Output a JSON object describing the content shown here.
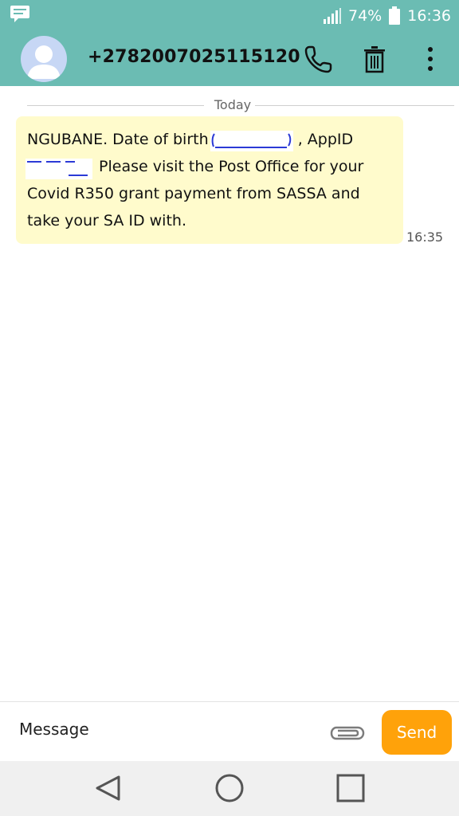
{
  "status_bar": {
    "battery": "74%",
    "time": "16:36"
  },
  "conversation": {
    "contact": "+2782007025115120"
  },
  "thread": {
    "date_label": "Today",
    "message": {
      "line1_start": "NGUBANE. Date of birth",
      "line1_end": ", AppID",
      "line2_rest": "Please visit the Post Office for your",
      "line3": "Covid R350 grant payment from SASSA and",
      "line4": "take your SA ID with.",
      "time": "16:35"
    }
  },
  "composer": {
    "placeholder": "Message",
    "send_label": "Send"
  },
  "colors": {
    "accent": "#6bbcb3",
    "bubble": "#fffbcc",
    "send": "#ffa20a"
  },
  "icons": {
    "status_left": "message-notification-icon",
    "signal": "signal-icon",
    "battery": "battery-icon",
    "call": "phone-icon",
    "delete": "trash-icon",
    "more": "more-vertical-icon",
    "attach": "paperclip-icon",
    "back": "back-icon",
    "home": "home-icon",
    "recents": "recents-icon"
  }
}
